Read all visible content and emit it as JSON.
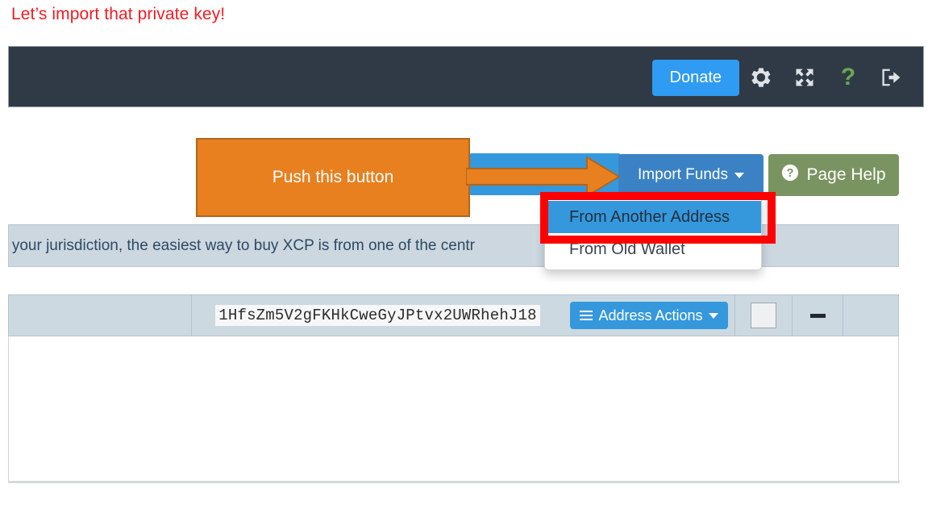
{
  "instruction": {
    "title": "Let’s import that private key!",
    "color": "#ee1c25"
  },
  "navbar": {
    "background_color": "#2f3a46",
    "donate_label": "Donate",
    "donate_color": "#2f9bf2",
    "icons": [
      {
        "name": "gear-icon",
        "glyph": "settings"
      },
      {
        "name": "expand-icon",
        "glyph": "fullscreen"
      },
      {
        "name": "help-question-icon",
        "glyph": "?",
        "color": "#6aa84f"
      },
      {
        "name": "logout-icon",
        "glyph": "sign-out"
      }
    ]
  },
  "callout": {
    "label": "Push this button",
    "fill_color": "#e8801f",
    "border_color": "#b5651a",
    "arrow_name": "arrow-right"
  },
  "toolbar": {
    "import_funds_label": "Import Funds",
    "import_funds_color": "#3b82c4",
    "page_help_label": "Page Help",
    "page_help_color": "#7a9461",
    "page_help_icon": "question-circle-icon"
  },
  "dropdown": {
    "items": [
      {
        "label": "From Another Address",
        "active": true
      },
      {
        "label": "From Old Wallet",
        "active": false
      }
    ],
    "highlight_color": "#fe0000",
    "active_color": "#3598dc"
  },
  "banner": {
    "text": "n your jurisdiction, the easiest way to buy XCP is from one of the centr",
    "background_color": "#ccd7e0",
    "text_color": "#2d4a63"
  },
  "address_row": {
    "address": "1HfsZm5V2gFKHkCweGyJPtvx2UWRhehJ18",
    "actions_label": "Address Actions",
    "actions_color": "#3598dc",
    "menu_icon": "hamburger-icon",
    "checkbox_name": "row-checkbox",
    "collapse_name": "collapse-dash-icon",
    "background_color": "#ccd9e1"
  }
}
